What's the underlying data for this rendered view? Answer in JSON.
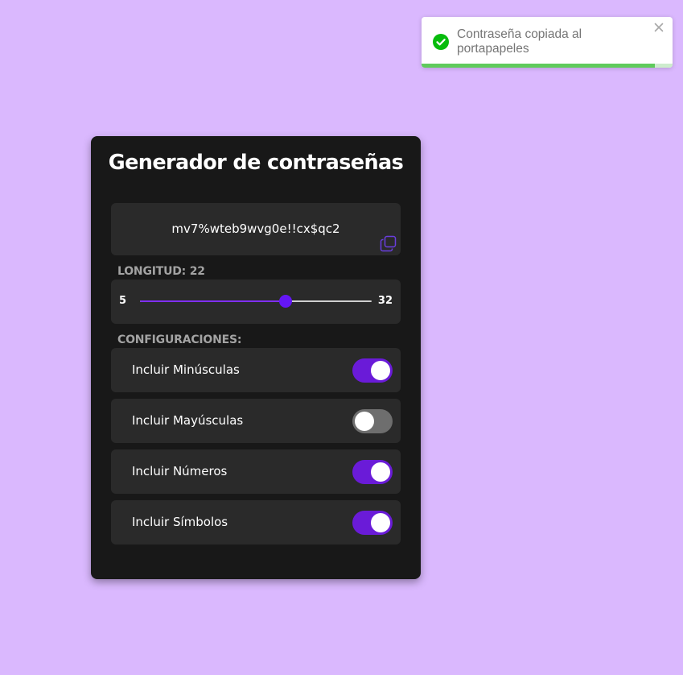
{
  "colors": {
    "background": "#dab8fe",
    "card": "#181818",
    "panel": "#2a2a2a",
    "accent": "#6a1bd8",
    "toggle_off": "#6e6e6e",
    "toast_success": "#07bc0c"
  },
  "toast": {
    "icon": "check-circle-icon",
    "message": "Contraseña copiada al portapapeles",
    "close_icon": "close-icon",
    "progress": 0.93
  },
  "generator": {
    "title": "Generador de contraseñas",
    "password": "mv7%wteb9wvg0e!!cx$qc2",
    "copy_icon": "copy-icon",
    "length_label": "LONGITUD: 22",
    "length": {
      "min": 5,
      "max": 32,
      "value": 22,
      "min_label": "5",
      "max_label": "32"
    },
    "config_label": "CONFIGURACIONES:",
    "options": [
      {
        "label": "Incluir Minúsculas",
        "enabled": true
      },
      {
        "label": "Incluir Mayúsculas",
        "enabled": false
      },
      {
        "label": "Incluir Números",
        "enabled": true
      },
      {
        "label": "Incluir Símbolos",
        "enabled": true
      }
    ]
  }
}
